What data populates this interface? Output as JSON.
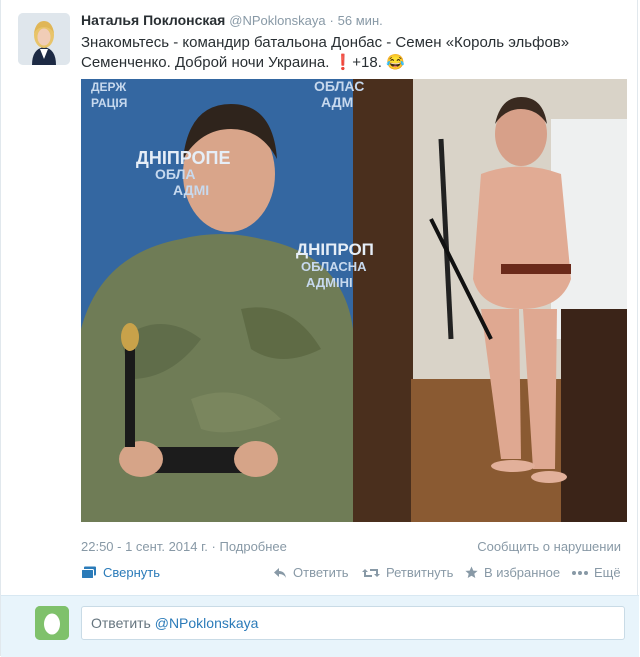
{
  "tweet": {
    "author_name": "Наталья Поклонская",
    "author_handle": "@NPoklonskaya",
    "time_separator": "·",
    "relative_time": "56 мин.",
    "text_line1": "Знакомьтесь - командир батальона Донбас - Семен «Король эльфов»",
    "text_line2": "Семенченко. Доброй ночи Украина.",
    "text_extra": "+18.",
    "emoji_exclamation": "❗",
    "emoji_laugh": "😂",
    "timestamp": "22:50 - 1 сент. 2014 г.",
    "details_separator": "·",
    "details_link": "Подробнее",
    "report_link": "Сообщить о нарушении",
    "media_sign_left": [
      "ОБЛАС",
      "АДМ",
      "ДНІПРОПЕ",
      "ОБЛА",
      "АДМІ",
      "ДНІПРОП",
      "ОБЛАСНА",
      "АДМІНІ"
    ],
    "media_sign_top": [
      "ДЕРЖ",
      "РАЦІЯ"
    ]
  },
  "actions": {
    "collapse": "Свернуть",
    "reply": "Ответить",
    "retweet": "Ретвитнуть",
    "favorite": "В избранное",
    "more": "Ещё"
  },
  "reply_box": {
    "prefix": "Ответить",
    "mention": "@NPoklonskaya"
  },
  "colors": {
    "link": "#2b7bb9",
    "muted": "#8899a6",
    "reply_bg": "#e8f4fb",
    "egg": "#7fc16b"
  }
}
